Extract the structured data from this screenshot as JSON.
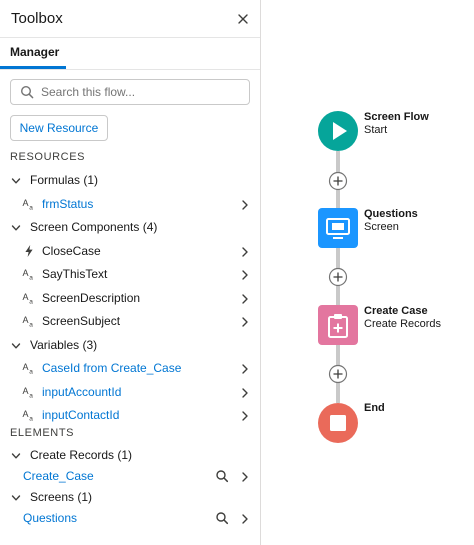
{
  "toolbox": {
    "title": "Toolbox",
    "tab": "Manager",
    "search_placeholder": "Search this flow...",
    "new_resource": "New Resource",
    "resources_heading": "RESOURCES",
    "elements_heading": "ELEMENTS",
    "groups": [
      {
        "label": "Formulas (1)",
        "items": [
          {
            "label": "frmStatus",
            "icon": "text-type-icon",
            "link": true
          }
        ]
      },
      {
        "label": "Screen Components (4)",
        "items": [
          {
            "label": "CloseCase",
            "icon": "bolt-icon",
            "link": false
          },
          {
            "label": "SayThisText",
            "icon": "text-type-icon",
            "link": false
          },
          {
            "label": "ScreenDescription",
            "icon": "text-type-icon",
            "link": false
          },
          {
            "label": "ScreenSubject",
            "icon": "text-type-icon",
            "link": false
          }
        ]
      },
      {
        "label": "Variables (3)",
        "items": [
          {
            "label": "CaseId from Create_Case",
            "icon": "text-type-icon",
            "link": true
          },
          {
            "label": "inputAccountId",
            "icon": "text-type-icon",
            "link": true
          },
          {
            "label": "inputContactId",
            "icon": "text-type-icon",
            "link": true
          }
        ]
      }
    ],
    "element_groups": [
      {
        "label": "Create Records (1)",
        "items": [
          {
            "label": "Create_Case"
          }
        ]
      },
      {
        "label": "Screens (1)",
        "items": [
          {
            "label": "Questions"
          }
        ]
      }
    ]
  },
  "flow": {
    "nodes": [
      {
        "title": "Screen Flow",
        "subtitle": "Start",
        "color": "#06a59a",
        "icon": "play-icon"
      },
      {
        "title": "Questions",
        "subtitle": "Screen",
        "color": "#1b96ff",
        "icon": "screen-icon"
      },
      {
        "title": "Create Case",
        "subtitle": "Create Records",
        "color": "#e3769f",
        "icon": "clipboard-plus-icon"
      },
      {
        "title": "End",
        "subtitle": "",
        "color": "#ea6a5a",
        "icon": "stop-icon"
      }
    ],
    "connector_color": "#c9c9c9"
  }
}
